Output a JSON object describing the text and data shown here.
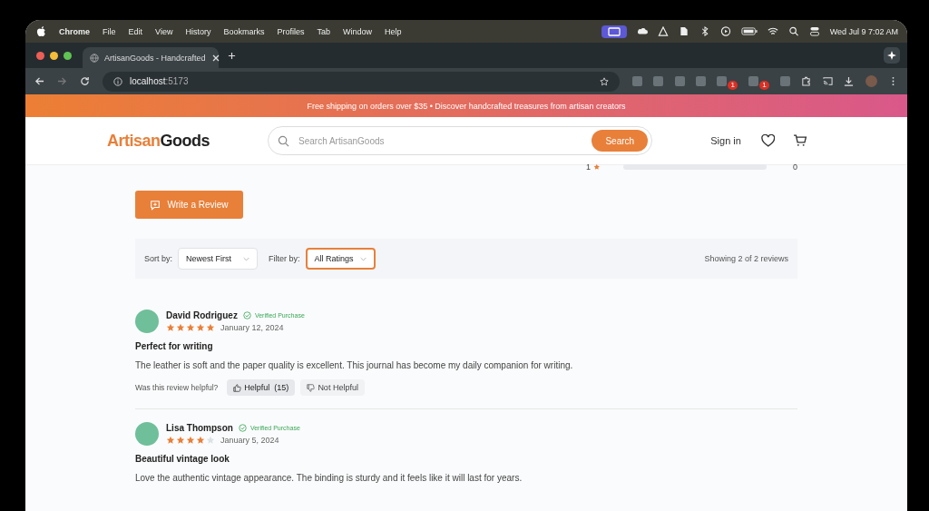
{
  "menu_bar": {
    "app": "Chrome",
    "items": [
      "File",
      "Edit",
      "View",
      "History",
      "Bookmarks",
      "Profiles",
      "Tab",
      "Window",
      "Help"
    ],
    "clock": "Wed Jul 9  7:02 AM"
  },
  "browser": {
    "tab_title": "ArtisanGoods - Handcrafted",
    "url_host": "localhost",
    "url_port": ":5173",
    "extensions": [
      {
        "kind": "plain"
      },
      {
        "kind": "plain"
      },
      {
        "kind": "plain"
      },
      {
        "kind": "plain"
      },
      {
        "kind": "badge",
        "badge": "1"
      },
      {
        "kind": "badge",
        "badge": "1"
      },
      {
        "kind": "plain"
      }
    ]
  },
  "banner": "Free shipping on orders over $35 • Discover handcrafted treasures from artisan creators",
  "header": {
    "logo_part1": "Artisan",
    "logo_part2": "Goods",
    "search_placeholder": "Search ArtisanGoods",
    "search_button": "Search",
    "sign_in": "Sign in"
  },
  "rating_row": {
    "label": "1",
    "level": 0,
    "count": "0"
  },
  "write_review": "Write a Review",
  "filters": {
    "sort_label": "Sort by:",
    "sort_value": "Newest First",
    "filter_label": "Filter by:",
    "filter_value": "All Ratings",
    "showing": "Showing 2 of 2 reviews"
  },
  "reviews": [
    {
      "name": "David Rodriguez",
      "verified": true,
      "verified_label": "Verified Purchase",
      "stars": 5,
      "date": "January 12, 2024",
      "title": "Perfect for writing",
      "body": "The leather is soft and the paper quality is excellent. This journal has become my daily companion for writing.",
      "helpful_prompt": "Was this review helpful?",
      "helpful": "Helpful",
      "helpful_count": "(15)",
      "not_helpful": "Not Helpful"
    },
    {
      "name": "Lisa Thompson",
      "verified": true,
      "verified_label": "Verified Purchase",
      "stars": 4,
      "date": "January 5, 2024",
      "title": "Beautiful vintage look",
      "body": "Love the authentic vintage appearance. The binding is sturdy and it feels like it will last for years."
    }
  ]
}
